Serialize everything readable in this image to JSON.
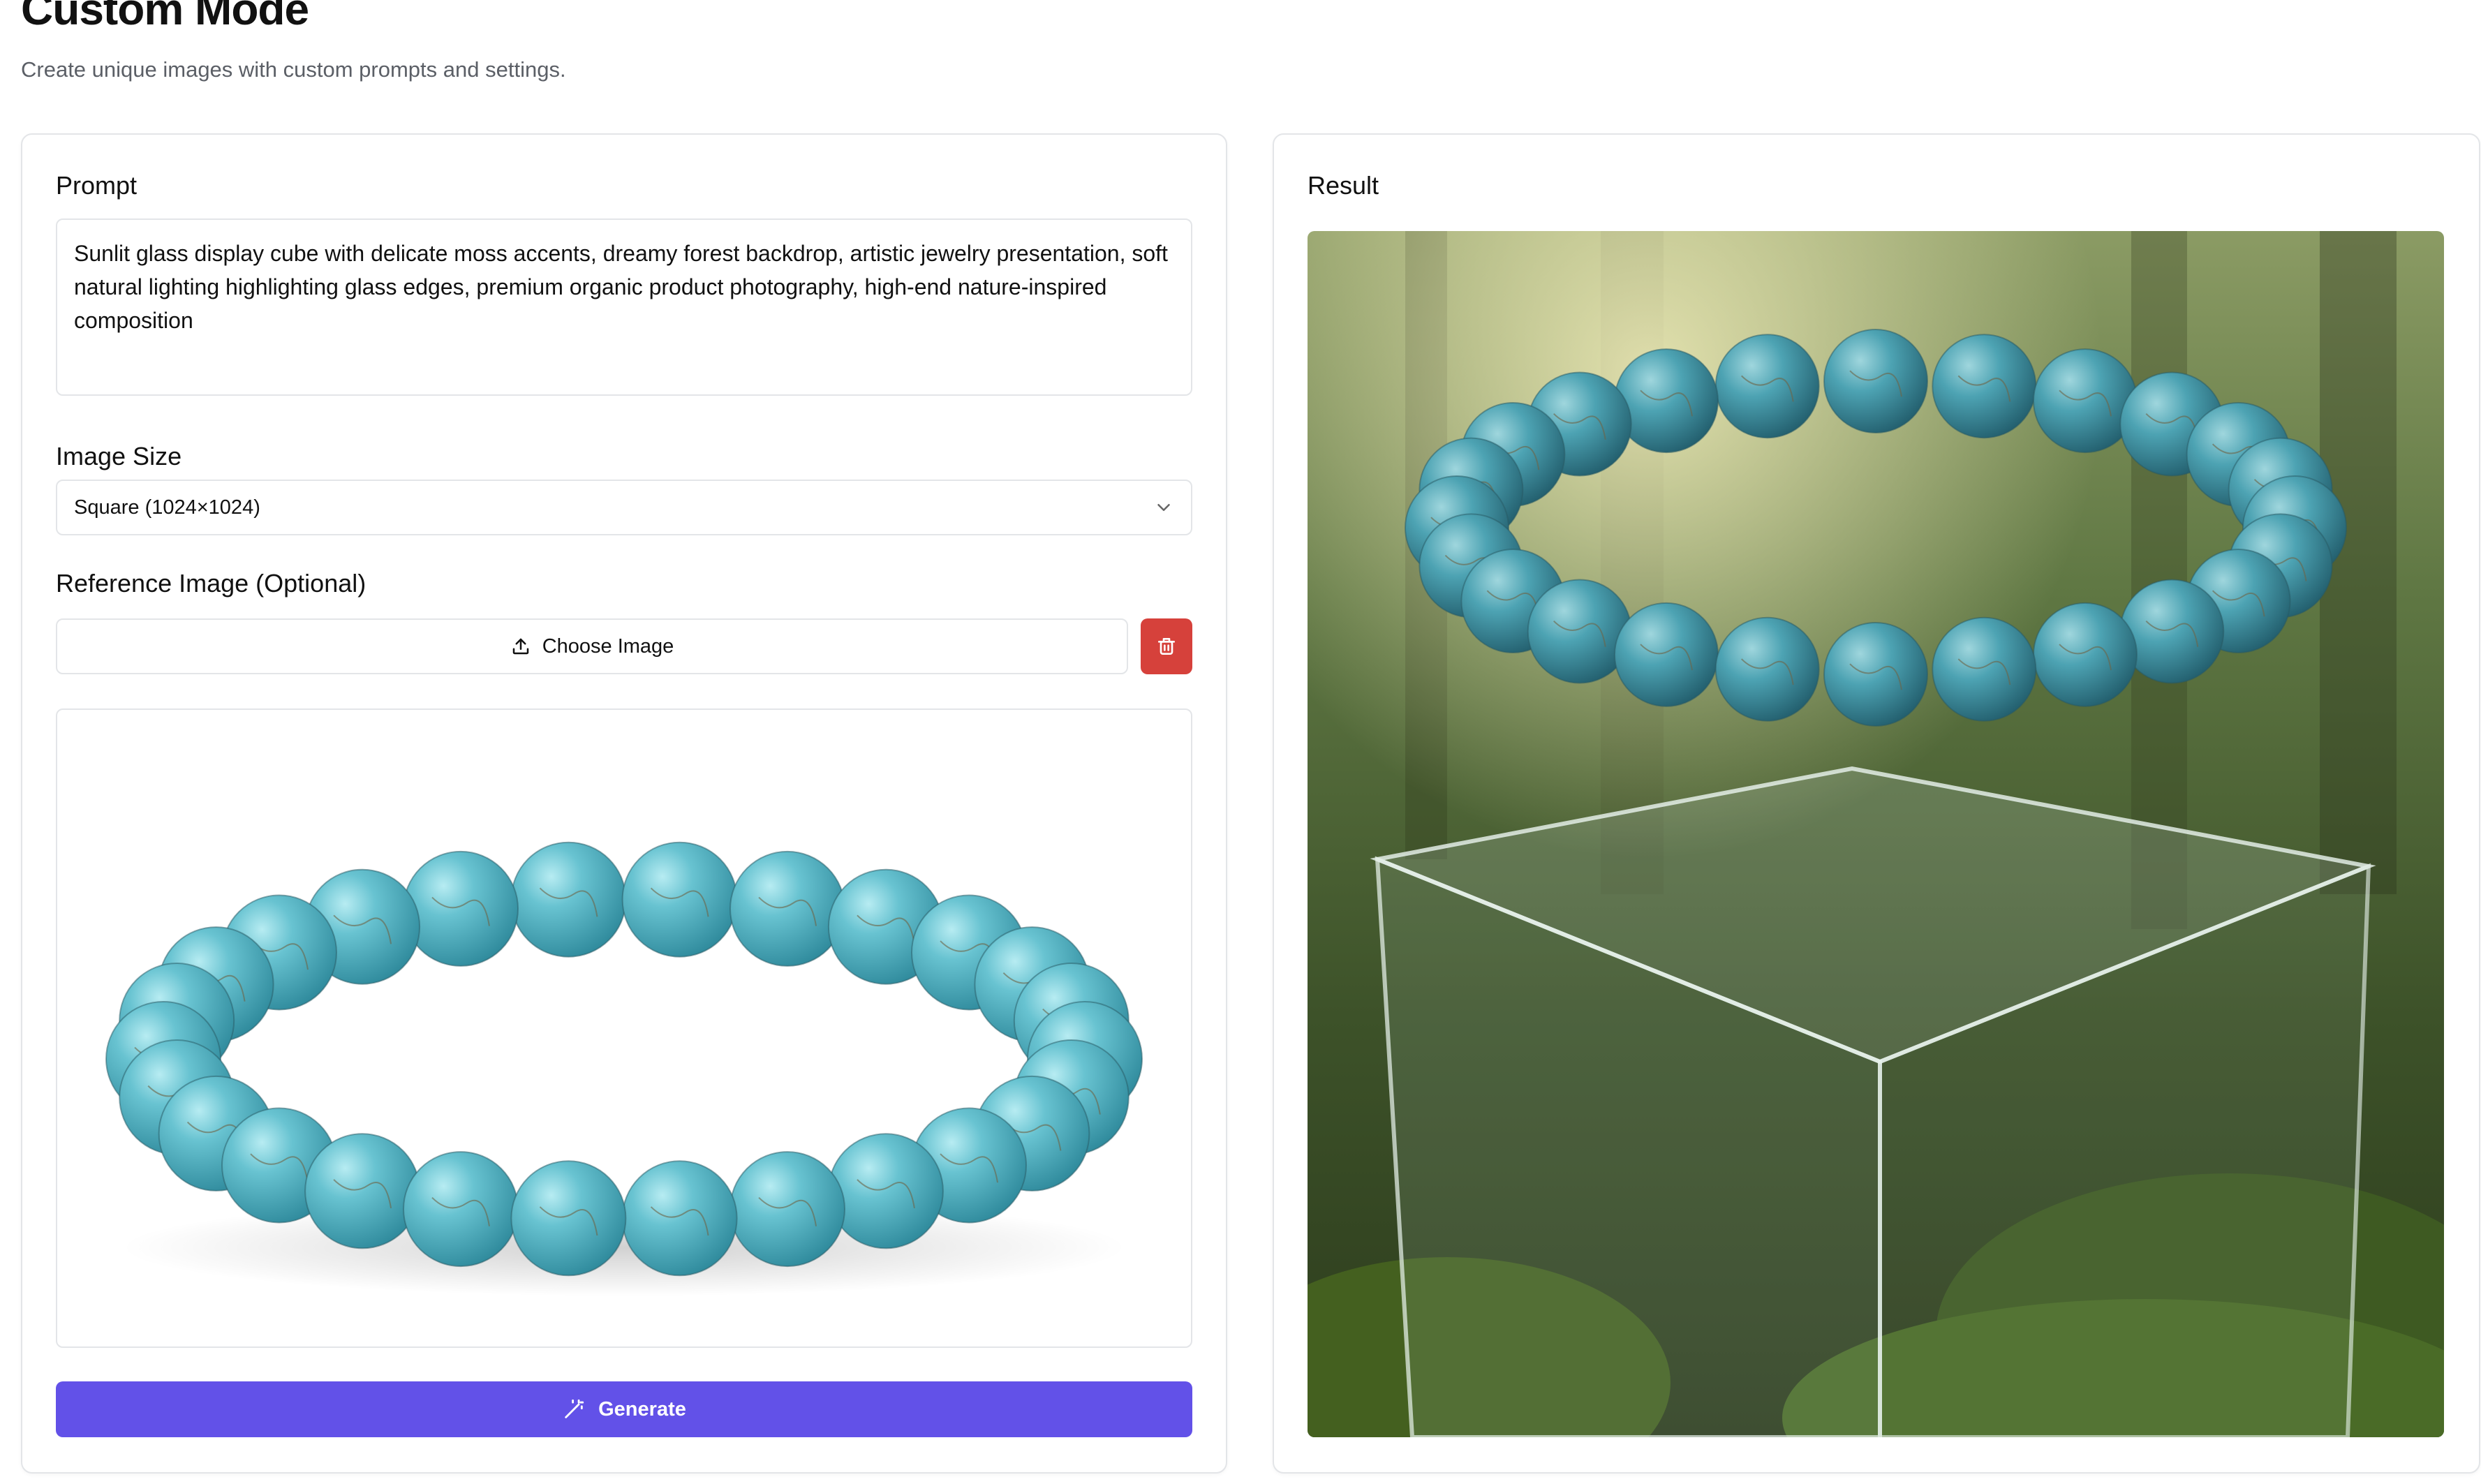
{
  "page": {
    "title": "Custom Mode",
    "subtitle": "Create unique images with custom prompts and settings."
  },
  "form": {
    "prompt_label": "Prompt",
    "prompt_value": "Sunlit glass display cube with delicate moss accents, dreamy forest backdrop, artistic jewelry presentation, soft natural lighting highlighting glass edges, premium organic product photography, high-end nature-inspired composition",
    "size_label": "Image Size",
    "size_value": "Square (1024×1024)",
    "reference_label": "Reference Image (Optional)",
    "choose_label": "Choose Image",
    "generate_label": "Generate"
  },
  "result": {
    "label": "Result"
  },
  "colors": {
    "accent": "#6251e8",
    "danger": "#d6413b",
    "bead": "#4fb3c4"
  },
  "icons": {
    "upload": "upload-icon",
    "trash": "trash-icon",
    "chevron": "chevron-down-icon",
    "wand": "magic-wand-icon"
  }
}
